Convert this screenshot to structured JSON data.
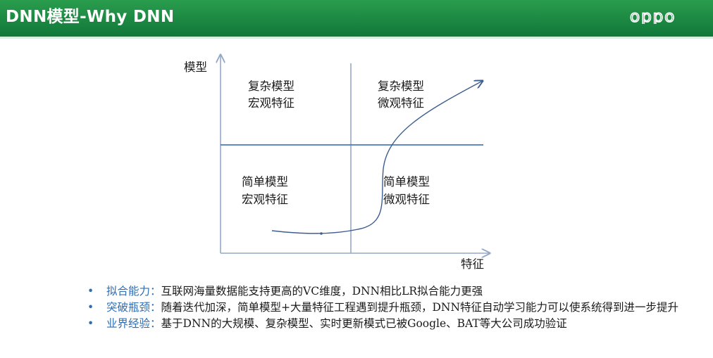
{
  "slide": {
    "title": "DNN模型-Why DNN",
    "logo": "oppo"
  },
  "diagram": {
    "y_axis_label": "模型",
    "x_axis_label": "特征",
    "quadrants": {
      "top_left": [
        "复杂模型",
        "宏观特征"
      ],
      "top_right": [
        "复杂模型",
        "微观特征"
      ],
      "bottom_left": [
        "简单模型",
        "宏观特征"
      ],
      "bottom_right": [
        "简单模型",
        "微观特征"
      ]
    },
    "colors": {
      "axis": "#95a9c7",
      "divider": "#4a7ab8",
      "curve": "#3d5e8f"
    }
  },
  "bullets": [
    {
      "marker": "•",
      "key": "拟合能力：",
      "text": "互联网海量数据能支持更高的VC维度，DNN相比LR拟合能力更强"
    },
    {
      "marker": "•",
      "key": "突破瓶颈：",
      "text": "随着迭代加深，简单模型+大量特征工程遇到提升瓶颈，DNN特征自动学习能力可以使系统得到进一步提升"
    },
    {
      "marker": "•",
      "key": "业界经验：",
      "text": "基于DNN的大规模、复杂模型、实时更新模式已被Google、BAT等大公司成功验证"
    }
  ]
}
